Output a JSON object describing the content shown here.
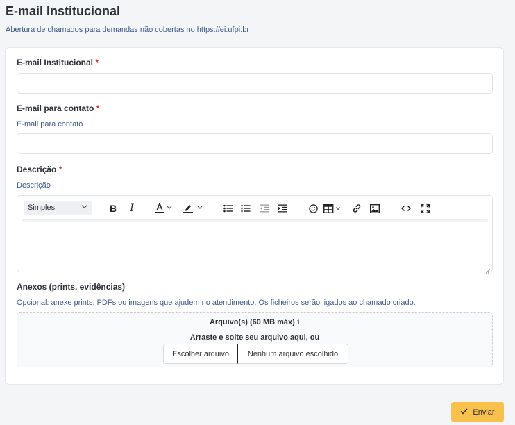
{
  "page": {
    "title": "E-mail Institucional",
    "subtitle": "Abertura de chamados para demandas não cobertas no https://ei.ufpi.br"
  },
  "form": {
    "institutional_email": {
      "label": "E-mail Institucional",
      "required_mark": "*",
      "value": "",
      "placeholder": ""
    },
    "contact_email": {
      "label": "E-mail para contato",
      "required_mark": "*",
      "hint": "E-mail para contato",
      "value": "",
      "placeholder": ""
    },
    "description": {
      "label": "Descrição",
      "required_mark": "*",
      "hint": "Descrição",
      "editor": {
        "format_select": "Simples",
        "content": ""
      }
    },
    "attachments": {
      "label": "Anexos (prints, evidências)",
      "hint": "Opcional: anexe prints, PDFs ou imagens que ajudem no atendimento. Os ficheiros serão ligados ao chamado criado.",
      "size_label": "Arquivo(s) (60 MB máx)",
      "info_glyph": "ℹ",
      "drop_text": "Arraste e solte seu arquivo aqui, ou",
      "choose_button": "Escolher arquivo",
      "no_file": "Nenhum arquivo escolhido"
    }
  },
  "actions": {
    "submit_label": "Enviar"
  },
  "colors": {
    "accent": "#f7c14b",
    "required": "#d93636",
    "hint_text": "#3c5a8a"
  },
  "icons": {
    "toolbar": [
      "bold-icon",
      "italic-icon",
      "font-color-icon",
      "highlight-icon",
      "bullet-list-icon",
      "numbered-list-icon",
      "outdent-icon",
      "indent-icon",
      "emoji-icon",
      "table-icon",
      "link-icon",
      "image-icon",
      "code-view-icon",
      "fullscreen-icon"
    ],
    "submit": "check-icon"
  }
}
